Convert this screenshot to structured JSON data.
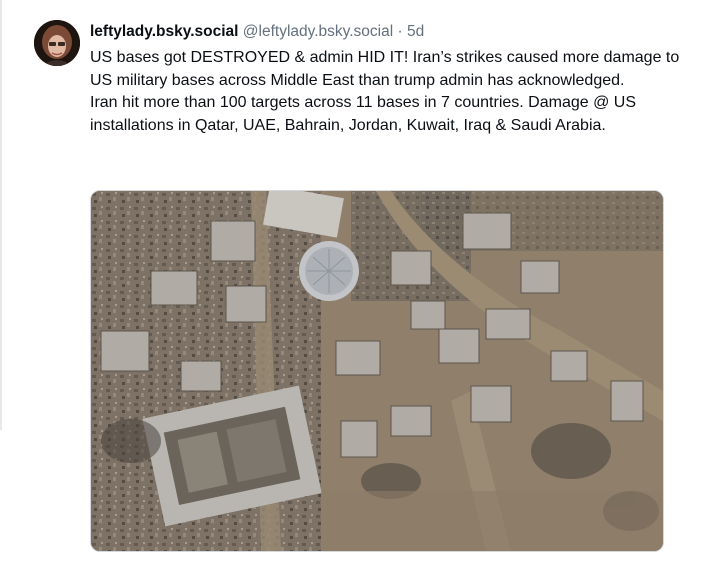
{
  "post": {
    "author_display": "leftylady.bsky.social",
    "author_handle": "@leftylady.bsky.social",
    "separator": "·",
    "timestamp": "5d",
    "paragraphs": [
      "US bases got DESTROYED & admin HID IT! Iran’s strikes caused more damage to US military bases across Middle East than trump admin has acknowledged.",
      "Iran hit more than 100 targets across 11 bases in 7 countries. Damage @ US installations in Qatar, UAE, Bahrain, Jordan, Kuwait, Iraq & Saudi Arabia."
    ],
    "media": {
      "kind": "satellite-image"
    }
  },
  "colors": {
    "text": "#0b0f14",
    "muted": "#64707d",
    "ground": "#8a7b6a"
  }
}
